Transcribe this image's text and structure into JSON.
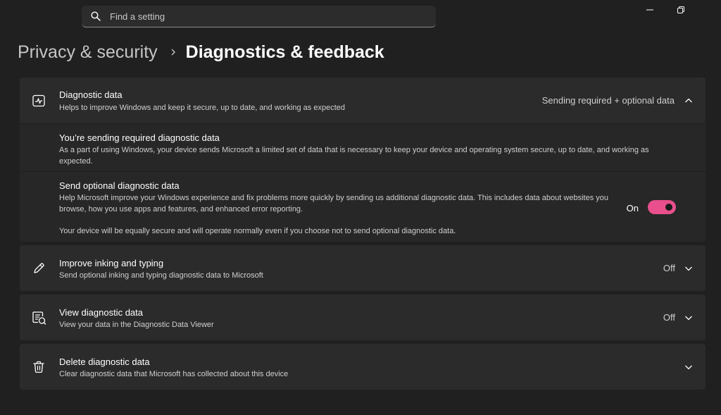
{
  "search": {
    "placeholder": "Find a setting"
  },
  "breadcrumb": {
    "parent": "Privacy & security",
    "current": "Diagnostics & feedback"
  },
  "diagnostic_data": {
    "title": "Diagnostic data",
    "subtitle": "Helps to improve Windows and keep it secure, up to date, and working as expected",
    "value": "Sending required + optional data",
    "required": {
      "title": "You’re sending required diagnostic data",
      "description": "As a part of using Windows, your device sends Microsoft a limited set of data that is necessary to keep your device and operating system secure, up to date, and working as expected."
    },
    "optional": {
      "title": "Send optional diagnostic data",
      "description": "Help Microsoft improve your Windows experience and fix problems more quickly by sending us additional diagnostic data. This includes data about websites you browse, how you use apps and features, and enhanced error reporting.",
      "note": "Your device will be equally secure and will operate normally even if you choose not to send optional diagnostic data.",
      "toggle_state": "On"
    }
  },
  "inking": {
    "title": "Improve inking and typing",
    "subtitle": "Send optional inking and typing diagnostic data to Microsoft",
    "value": "Off"
  },
  "viewer": {
    "title": "View diagnostic data",
    "subtitle": "View your data in the Diagnostic Data Viewer",
    "value": "Off"
  },
  "delete": {
    "title": "Delete diagnostic data",
    "subtitle": "Clear diagnostic data that Microsoft has collected about this device"
  },
  "colors": {
    "accent": "#ea4f8d",
    "background": "#202020",
    "card": "#2b2b2b"
  }
}
